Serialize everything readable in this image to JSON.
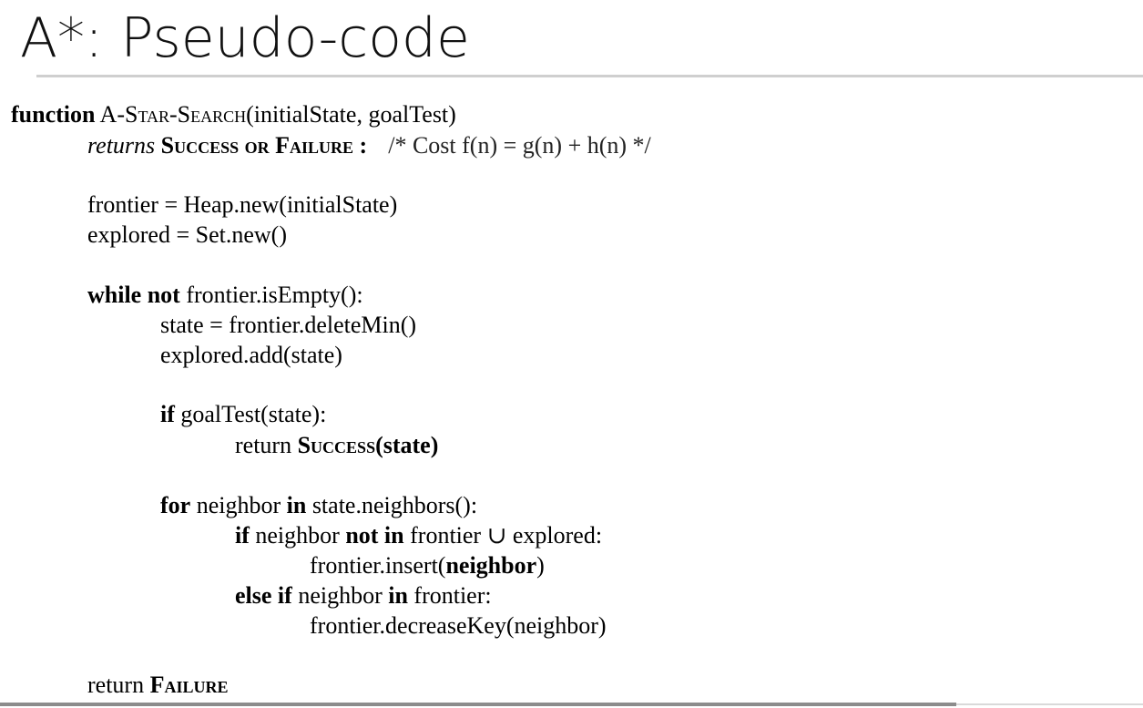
{
  "title": "A*: Pseudo-code",
  "code": {
    "line1": {
      "keyword": "function",
      "name_prefix": "A-",
      "name_sc": "Star-Search",
      "args": "(initialState, goalTest)"
    },
    "line2": {
      "returns": "returns",
      "success": "Success",
      "or": "or",
      "failure": "Failure",
      "colon": ":",
      "comment": "/* Cost f(n) = g(n) + h(n) */"
    },
    "line3": "frontier = Heap.new(initialState)",
    "line4": "explored = Set.new()",
    "line5": {
      "while_not": "while not",
      "rest": " frontier.isEmpty():"
    },
    "line6": "state = frontier.deleteMin()",
    "line7": "explored.add(state)",
    "line8": {
      "kw": "if",
      "rest": " goalTest(state):"
    },
    "line9": {
      "ret": "return ",
      "success": "Success",
      "args": "(state)"
    },
    "line10": {
      "for": "for",
      "mid": " neighbor ",
      "in": "in",
      "rest": " state.neighbors():"
    },
    "line11": {
      "if": "if",
      "mid1": " neighbor ",
      "not_in": "not in",
      "rest": " frontier ∪ explored:"
    },
    "line12": {
      "pre": "frontier.insert(",
      "arg": "neighbor",
      "post": ")"
    },
    "line13": {
      "else_if": "else if",
      "mid": " neighbor ",
      "in": "in",
      "rest": " frontier:"
    },
    "line14": "frontier.decreaseKey(neighbor)",
    "line15": {
      "ret": "return ",
      "failure": "Failure"
    }
  }
}
